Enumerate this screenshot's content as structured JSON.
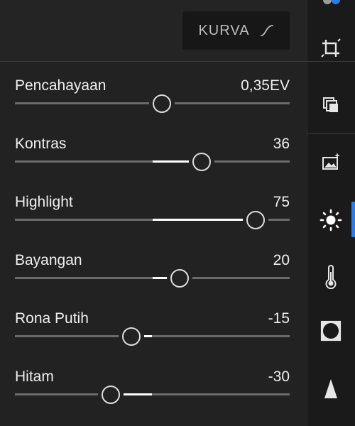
{
  "header": {
    "curve_button_label": "KURVA"
  },
  "sliders": [
    {
      "label": "Pencahayaan",
      "value_text": "0,35EV",
      "value": 0.35,
      "min": -5,
      "max": 5,
      "thumb_fraction": 0.535,
      "fill_from": 0.5,
      "fill_to": 0.5
    },
    {
      "label": "Kontras",
      "value_text": "36",
      "value": 36,
      "min": -100,
      "max": 100,
      "thumb_fraction": 0.68,
      "fill_from": 0.5,
      "fill_to": 0.68
    },
    {
      "label": "Highlight",
      "value_text": "75",
      "value": 75,
      "min": -100,
      "max": 100,
      "thumb_fraction": 0.875,
      "fill_from": 0.5,
      "fill_to": 0.875
    },
    {
      "label": "Bayangan",
      "value_text": "20",
      "value": 20,
      "min": -100,
      "max": 100,
      "thumb_fraction": 0.6,
      "fill_from": 0.5,
      "fill_to": 0.6
    },
    {
      "label": "Rona Putih",
      "value_text": "-15",
      "value": -15,
      "min": -100,
      "max": 100,
      "thumb_fraction": 0.425,
      "fill_from": 0.425,
      "fill_to": 0.5
    },
    {
      "label": "Hitam",
      "value_text": "-30",
      "value": -30,
      "min": -100,
      "max": 100,
      "thumb_fraction": 0.35,
      "fill_from": 0.35,
      "fill_to": 0.5
    }
  ],
  "toolbar": {
    "items": [
      {
        "name": "presets-icon",
        "active": false
      },
      {
        "name": "crop-icon",
        "active": false
      },
      {
        "name": "layers-icon",
        "active": false
      },
      {
        "name": "auto-enhance-icon",
        "active": false
      },
      {
        "name": "light-icon",
        "active": true
      },
      {
        "name": "color-temperature-icon",
        "active": false
      },
      {
        "name": "vignette-icon",
        "active": false
      },
      {
        "name": "detail-icon",
        "active": false
      }
    ],
    "accent_color": "#2d7be5"
  }
}
